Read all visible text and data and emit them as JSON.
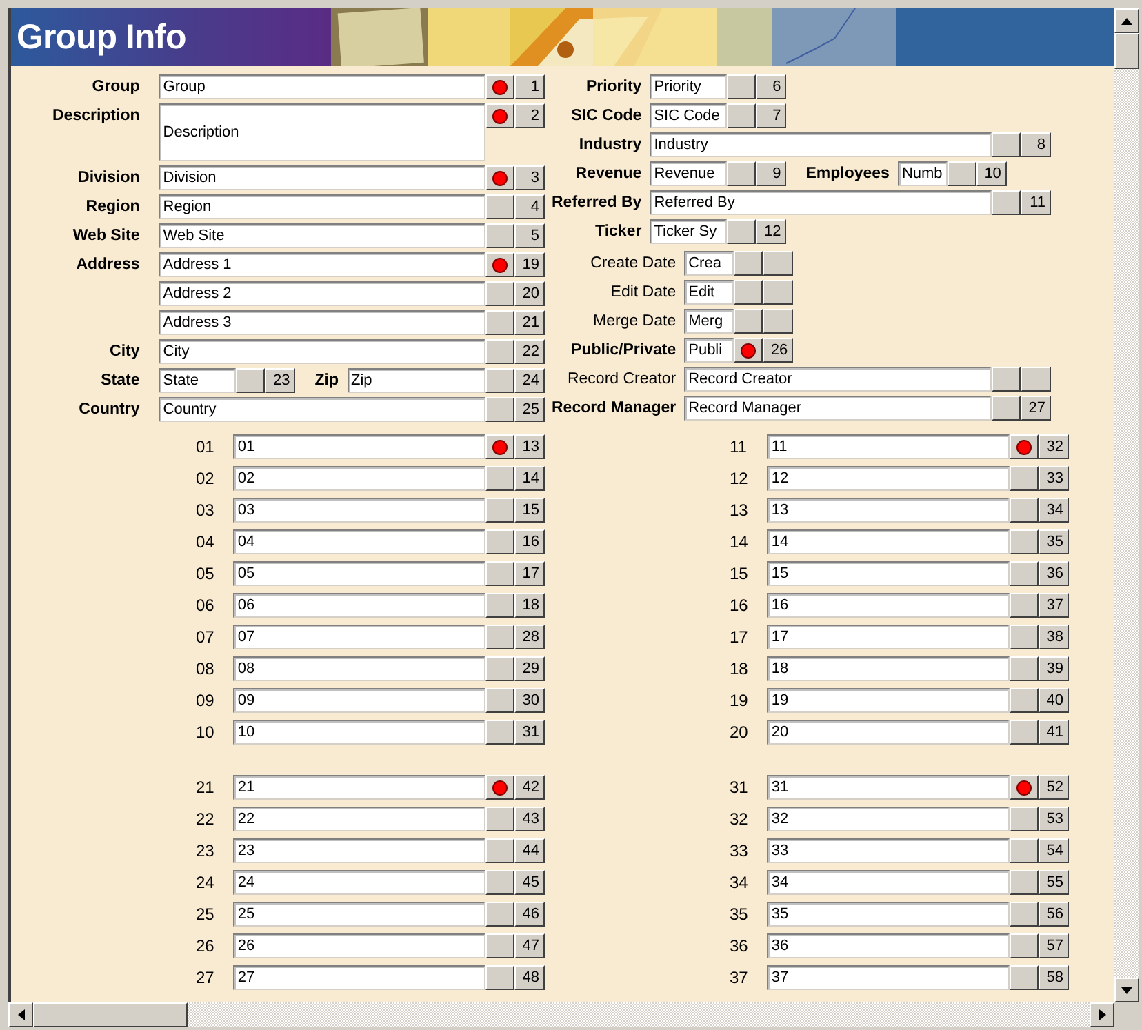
{
  "window": {
    "title": "Group Info"
  },
  "left_sections": [
    {
      "rows": [
        {
          "fields": [
            {
              "label": "Group",
              "label_bold": true,
              "value": "Group",
              "kind": "long",
              "required": true,
              "number": "1"
            }
          ]
        },
        {
          "fields": [
            {
              "label": "Description",
              "label_bold": true,
              "value": "Description",
              "kind": "memo",
              "required": true,
              "number": "2"
            }
          ]
        },
        {
          "fields": [
            {
              "label": "Division",
              "label_bold": true,
              "value": "Division",
              "kind": "long",
              "required": true,
              "number": "3"
            }
          ]
        },
        {
          "fields": [
            {
              "label": "Region",
              "label_bold": true,
              "value": "Region",
              "kind": "long",
              "required": false,
              "number": "4"
            }
          ]
        },
        {
          "fields": [
            {
              "label": "Web Site",
              "label_bold": true,
              "value": "Web Site",
              "kind": "long",
              "required": false,
              "number": "5"
            }
          ]
        },
        {
          "fields": [
            {
              "label": "Address",
              "label_bold": true,
              "value": "Address 1",
              "kind": "long",
              "required": true,
              "number": "19"
            }
          ]
        },
        {
          "fields": [
            {
              "value": "Address 2",
              "kind": "long",
              "required": false,
              "number": "20"
            }
          ]
        },
        {
          "fields": [
            {
              "value": "Address 3",
              "kind": "long",
              "required": false,
              "number": "21"
            }
          ]
        },
        {
          "fields": [
            {
              "label": "City",
              "label_bold": true,
              "value": "City",
              "kind": "long",
              "required": false,
              "number": "22"
            }
          ]
        },
        {
          "fields": [
            {
              "label": "State",
              "label_bold": true,
              "value": "State",
              "kind": "short",
              "required": false,
              "number": "23"
            },
            {
              "label": "Zip",
              "label_bold": true,
              "value": "Zip",
              "kind": "long",
              "required": false,
              "number": "24"
            }
          ]
        },
        {
          "fields": [
            {
              "label": "Country",
              "label_bold": true,
              "value": "Country",
              "kind": "long",
              "required": false,
              "number": "25"
            }
          ]
        }
      ]
    }
  ],
  "right_sections": [
    {
      "rows": [
        {
          "fields": [
            {
              "label": "Priority",
              "label_bold": true,
              "value": "Priority",
              "kind": "short",
              "required": false,
              "number": "6"
            }
          ]
        },
        {
          "fields": [
            {
              "label": "SIC Code",
              "label_bold": true,
              "value": "SIC Code",
              "kind": "short",
              "required": false,
              "number": "7"
            }
          ]
        },
        {
          "fields": [
            {
              "label": "Industry",
              "label_bold": true,
              "value": "Industry",
              "kind": "long",
              "required": false,
              "number": "8"
            }
          ]
        },
        {
          "fields": [
            {
              "label": "Revenue",
              "label_bold": true,
              "value": "Revenue",
              "kind": "short",
              "required": false,
              "number": "9"
            },
            {
              "label": "Employees",
              "label_bold": true,
              "value": "Numb",
              "kind": "tiny",
              "required": false,
              "number": "10"
            }
          ]
        },
        {
          "fields": [
            {
              "label": "Referred By",
              "label_bold": true,
              "value": "Referred By",
              "kind": "long",
              "required": false,
              "number": "11"
            }
          ]
        },
        {
          "fields": [
            {
              "label": "Ticker",
              "label_bold": true,
              "value": "Ticker Sy",
              "kind": "short",
              "required": false,
              "number": "12"
            }
          ]
        }
      ]
    },
    {
      "rows": [
        {
          "fields": [
            {
              "label": "Create Date",
              "label_bold": false,
              "value": "Crea",
              "kind": "tiny",
              "required": false
            }
          ]
        },
        {
          "fields": [
            {
              "label": "Edit Date",
              "label_bold": false,
              "value": "Edit",
              "kind": "tiny",
              "required": false
            }
          ]
        },
        {
          "fields": [
            {
              "label": "Merge Date",
              "label_bold": false,
              "value": "Merg",
              "kind": "tiny",
              "required": false
            }
          ]
        },
        {
          "fields": [
            {
              "label": "Public/Private",
              "label_bold": true,
              "value": "Publi",
              "kind": "tiny",
              "required": true,
              "number": "26"
            }
          ]
        },
        {
          "fields": [
            {
              "label": "Record Creator",
              "label_bold": false,
              "value": "Record Creator",
              "kind": "long",
              "required": false
            }
          ]
        },
        {
          "fields": [
            {
              "label": "Record Manager",
              "label_bold": true,
              "value": "Record Manager",
              "kind": "long",
              "required": false,
              "number": "27"
            }
          ]
        }
      ]
    }
  ],
  "numbered": {
    "left": [
      {
        "items": [
          {
            "label": "01",
            "value": "01",
            "required": true,
            "number": "13"
          },
          {
            "label": "02",
            "value": "02",
            "required": false,
            "number": "14"
          },
          {
            "label": "03",
            "value": "03",
            "required": false,
            "number": "15"
          },
          {
            "label": "04",
            "value": "04",
            "required": false,
            "number": "16"
          },
          {
            "label": "05",
            "value": "05",
            "required": false,
            "number": "17"
          },
          {
            "label": "06",
            "value": "06",
            "required": false,
            "number": "18"
          },
          {
            "label": "07",
            "value": "07",
            "required": false,
            "number": "28"
          },
          {
            "label": "08",
            "value": "08",
            "required": false,
            "number": "29"
          },
          {
            "label": "09",
            "value": "09",
            "required": false,
            "number": "30"
          },
          {
            "label": "10",
            "value": "10",
            "required": false,
            "number": "31"
          }
        ]
      },
      {
        "items": [
          {
            "label": "21",
            "value": "21",
            "required": true,
            "number": "42"
          },
          {
            "label": "22",
            "value": "22",
            "required": false,
            "number": "43"
          },
          {
            "label": "23",
            "value": "23",
            "required": false,
            "number": "44"
          },
          {
            "label": "24",
            "value": "24",
            "required": false,
            "number": "45"
          },
          {
            "label": "25",
            "value": "25",
            "required": false,
            "number": "46"
          },
          {
            "label": "26",
            "value": "26",
            "required": false,
            "number": "47"
          },
          {
            "label": "27",
            "value": "27",
            "required": false,
            "number": "48"
          }
        ]
      }
    ],
    "right": [
      {
        "items": [
          {
            "label": "11",
            "value": "11",
            "required": true,
            "number": "32"
          },
          {
            "label": "12",
            "value": "12",
            "required": false,
            "number": "33"
          },
          {
            "label": "13",
            "value": "13",
            "required": false,
            "number": "34"
          },
          {
            "label": "14",
            "value": "14",
            "required": false,
            "number": "35"
          },
          {
            "label": "15",
            "value": "15",
            "required": false,
            "number": "36"
          },
          {
            "label": "16",
            "value": "16",
            "required": false,
            "number": "37"
          },
          {
            "label": "17",
            "value": "17",
            "required": false,
            "number": "38"
          },
          {
            "label": "18",
            "value": "18",
            "required": false,
            "number": "39"
          },
          {
            "label": "19",
            "value": "19",
            "required": false,
            "number": "40"
          },
          {
            "label": "20",
            "value": "20",
            "required": false,
            "number": "41"
          }
        ]
      },
      {
        "items": [
          {
            "label": "31",
            "value": "31",
            "required": true,
            "number": "52"
          },
          {
            "label": "32",
            "value": "32",
            "required": false,
            "number": "53"
          },
          {
            "label": "33",
            "value": "33",
            "required": false,
            "number": "54"
          },
          {
            "label": "34",
            "value": "34",
            "required": false,
            "number": "55"
          },
          {
            "label": "35",
            "value": "35",
            "required": false,
            "number": "56"
          },
          {
            "label": "36",
            "value": "36",
            "required": false,
            "number": "57"
          },
          {
            "label": "37",
            "value": "37",
            "required": false,
            "number": "58"
          }
        ]
      }
    ]
  }
}
